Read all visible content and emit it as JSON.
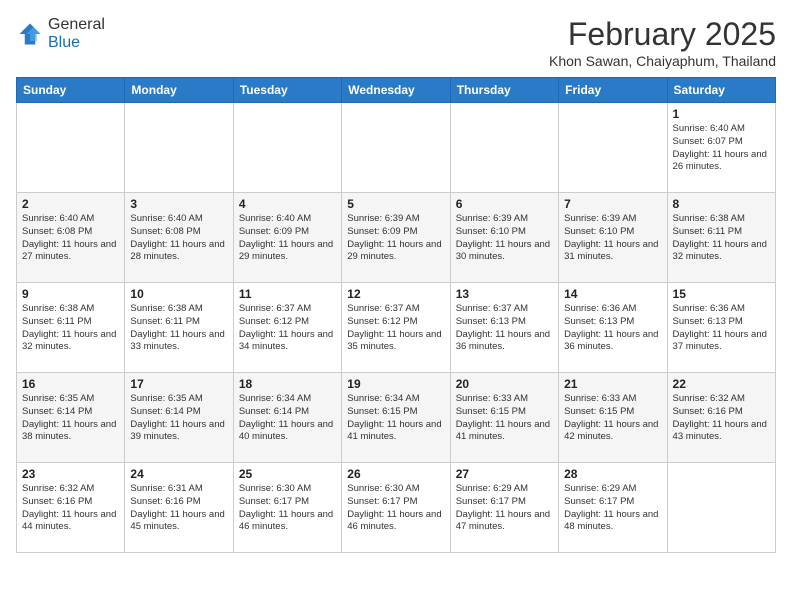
{
  "header": {
    "logo_line1": "General",
    "logo_line2": "Blue",
    "month_year": "February 2025",
    "location": "Khon Sawan, Chaiyaphum, Thailand"
  },
  "weekdays": [
    "Sunday",
    "Monday",
    "Tuesday",
    "Wednesday",
    "Thursday",
    "Friday",
    "Saturday"
  ],
  "weeks": [
    [
      {
        "day": "",
        "detail": ""
      },
      {
        "day": "",
        "detail": ""
      },
      {
        "day": "",
        "detail": ""
      },
      {
        "day": "",
        "detail": ""
      },
      {
        "day": "",
        "detail": ""
      },
      {
        "day": "",
        "detail": ""
      },
      {
        "day": "1",
        "detail": "Sunrise: 6:40 AM\nSunset: 6:07 PM\nDaylight: 11 hours\nand 26 minutes."
      }
    ],
    [
      {
        "day": "2",
        "detail": "Sunrise: 6:40 AM\nSunset: 6:08 PM\nDaylight: 11 hours\nand 27 minutes."
      },
      {
        "day": "3",
        "detail": "Sunrise: 6:40 AM\nSunset: 6:08 PM\nDaylight: 11 hours\nand 28 minutes."
      },
      {
        "day": "4",
        "detail": "Sunrise: 6:40 AM\nSunset: 6:09 PM\nDaylight: 11 hours\nand 29 minutes."
      },
      {
        "day": "5",
        "detail": "Sunrise: 6:39 AM\nSunset: 6:09 PM\nDaylight: 11 hours\nand 29 minutes."
      },
      {
        "day": "6",
        "detail": "Sunrise: 6:39 AM\nSunset: 6:10 PM\nDaylight: 11 hours\nand 30 minutes."
      },
      {
        "day": "7",
        "detail": "Sunrise: 6:39 AM\nSunset: 6:10 PM\nDaylight: 11 hours\nand 31 minutes."
      },
      {
        "day": "8",
        "detail": "Sunrise: 6:38 AM\nSunset: 6:11 PM\nDaylight: 11 hours\nand 32 minutes."
      }
    ],
    [
      {
        "day": "9",
        "detail": "Sunrise: 6:38 AM\nSunset: 6:11 PM\nDaylight: 11 hours\nand 32 minutes."
      },
      {
        "day": "10",
        "detail": "Sunrise: 6:38 AM\nSunset: 6:11 PM\nDaylight: 11 hours\nand 33 minutes."
      },
      {
        "day": "11",
        "detail": "Sunrise: 6:37 AM\nSunset: 6:12 PM\nDaylight: 11 hours\nand 34 minutes."
      },
      {
        "day": "12",
        "detail": "Sunrise: 6:37 AM\nSunset: 6:12 PM\nDaylight: 11 hours\nand 35 minutes."
      },
      {
        "day": "13",
        "detail": "Sunrise: 6:37 AM\nSunset: 6:13 PM\nDaylight: 11 hours\nand 36 minutes."
      },
      {
        "day": "14",
        "detail": "Sunrise: 6:36 AM\nSunset: 6:13 PM\nDaylight: 11 hours\nand 36 minutes."
      },
      {
        "day": "15",
        "detail": "Sunrise: 6:36 AM\nSunset: 6:13 PM\nDaylight: 11 hours\nand 37 minutes."
      }
    ],
    [
      {
        "day": "16",
        "detail": "Sunrise: 6:35 AM\nSunset: 6:14 PM\nDaylight: 11 hours\nand 38 minutes."
      },
      {
        "day": "17",
        "detail": "Sunrise: 6:35 AM\nSunset: 6:14 PM\nDaylight: 11 hours\nand 39 minutes."
      },
      {
        "day": "18",
        "detail": "Sunrise: 6:34 AM\nSunset: 6:14 PM\nDaylight: 11 hours\nand 40 minutes."
      },
      {
        "day": "19",
        "detail": "Sunrise: 6:34 AM\nSunset: 6:15 PM\nDaylight: 11 hours\nand 41 minutes."
      },
      {
        "day": "20",
        "detail": "Sunrise: 6:33 AM\nSunset: 6:15 PM\nDaylight: 11 hours\nand 41 minutes."
      },
      {
        "day": "21",
        "detail": "Sunrise: 6:33 AM\nSunset: 6:15 PM\nDaylight: 11 hours\nand 42 minutes."
      },
      {
        "day": "22",
        "detail": "Sunrise: 6:32 AM\nSunset: 6:16 PM\nDaylight: 11 hours\nand 43 minutes."
      }
    ],
    [
      {
        "day": "23",
        "detail": "Sunrise: 6:32 AM\nSunset: 6:16 PM\nDaylight: 11 hours\nand 44 minutes."
      },
      {
        "day": "24",
        "detail": "Sunrise: 6:31 AM\nSunset: 6:16 PM\nDaylight: 11 hours\nand 45 minutes."
      },
      {
        "day": "25",
        "detail": "Sunrise: 6:30 AM\nSunset: 6:17 PM\nDaylight: 11 hours\nand 46 minutes."
      },
      {
        "day": "26",
        "detail": "Sunrise: 6:30 AM\nSunset: 6:17 PM\nDaylight: 11 hours\nand 46 minutes."
      },
      {
        "day": "27",
        "detail": "Sunrise: 6:29 AM\nSunset: 6:17 PM\nDaylight: 11 hours\nand 47 minutes."
      },
      {
        "day": "28",
        "detail": "Sunrise: 6:29 AM\nSunset: 6:17 PM\nDaylight: 11 hours\nand 48 minutes."
      },
      {
        "day": "",
        "detail": ""
      }
    ]
  ]
}
